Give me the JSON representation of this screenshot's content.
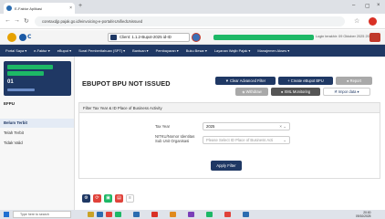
{
  "browser": {
    "tab_title": "E-Faktur Aplikasi",
    "url": "coretaxdjp.pajak.go.id/einvoicing-e-portal/eUnifiedUnissued",
    "win_controls": [
      "–",
      "▢",
      "×"
    ]
  },
  "header": {
    "logo_text": "Ⅽ",
    "client": "Client: 1.1.2-Bupot-2025  id-ID",
    "last_login": "Login terakhir: 09 Oktober 2025 20:00:00"
  },
  "nav": [
    "Portal Saya ▾",
    "e-Faktur ▾",
    "eBupot ▾",
    "Surat Pemberitahuan (SPT) ▾",
    "Bantuan ▾",
    "Pembayaran ▾",
    "Buku Besar ▾",
    "Layanan Wajib Pajak ▾",
    "Manajemen Akses ▾"
  ],
  "sidebar": {
    "code": "01",
    "section": "EFPU",
    "items": [
      {
        "label": "Belum Terbit",
        "active": true
      },
      {
        "label": "Telah Terbit",
        "active": false
      },
      {
        "label": "Tidak Valid",
        "active": false
      }
    ]
  },
  "page": {
    "title": "EBUPOT BPU NOT ISSUED",
    "buttons": {
      "clear_filter": "▼ Clear Advanced Filter",
      "create": "+ Create eBupot BPU",
      "report": "● Report",
      "withdraw": "◈ Withdraw",
      "xml_monitoring": "● XML Monitoring",
      "import": "🗎 Impor data ▾"
    }
  },
  "filter": {
    "header": "Filter Tax Year & ID Place of Business Activity",
    "tax_year_label": "Tax Year",
    "tax_year_value": "2025",
    "nitku_label": "NITKU/Nomor Identitas Sub Unit Organisasi",
    "nitku_placeholder": "Please Select ID Place of Business Acti",
    "apply_label": "Apply Filter"
  },
  "toolbar": [
    {
      "glyph": "⚙",
      "color": "#1f3864"
    },
    {
      "glyph": "⟳",
      "color": "#e0423a"
    },
    {
      "glyph": "▣",
      "color": "#1db866"
    },
    {
      "glyph": "▤",
      "color": "#e0423a"
    },
    {
      "glyph": "≡",
      "color": "#888888"
    }
  ],
  "taskbar": {
    "search": "Type here to search",
    "time": "20:00",
    "date": "09/10/2025"
  }
}
